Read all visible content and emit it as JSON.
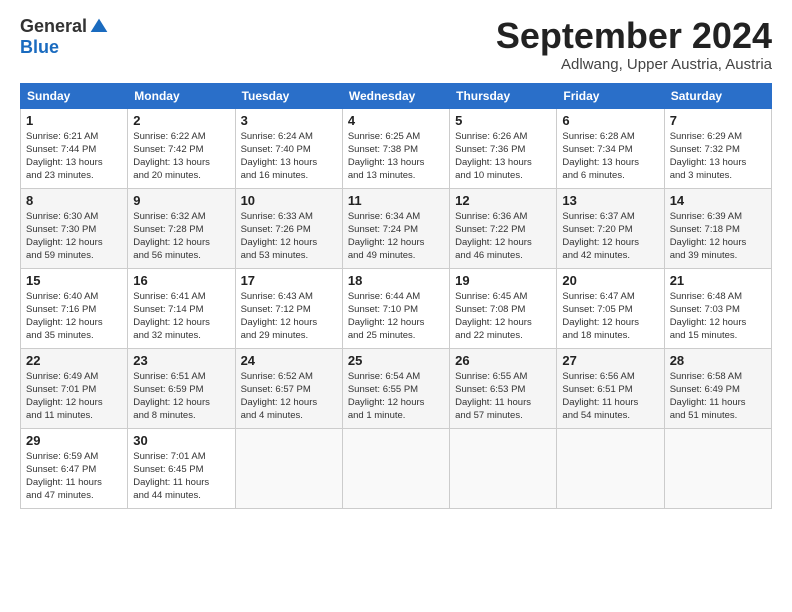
{
  "logo": {
    "general": "General",
    "blue": "Blue"
  },
  "title": "September 2024",
  "subtitle": "Adlwang, Upper Austria, Austria",
  "headers": [
    "Sunday",
    "Monday",
    "Tuesday",
    "Wednesday",
    "Thursday",
    "Friday",
    "Saturday"
  ],
  "weeks": [
    [
      {
        "day": "1",
        "info": "Sunrise: 6:21 AM\nSunset: 7:44 PM\nDaylight: 13 hours\nand 23 minutes."
      },
      {
        "day": "2",
        "info": "Sunrise: 6:22 AM\nSunset: 7:42 PM\nDaylight: 13 hours\nand 20 minutes."
      },
      {
        "day": "3",
        "info": "Sunrise: 6:24 AM\nSunset: 7:40 PM\nDaylight: 13 hours\nand 16 minutes."
      },
      {
        "day": "4",
        "info": "Sunrise: 6:25 AM\nSunset: 7:38 PM\nDaylight: 13 hours\nand 13 minutes."
      },
      {
        "day": "5",
        "info": "Sunrise: 6:26 AM\nSunset: 7:36 PM\nDaylight: 13 hours\nand 10 minutes."
      },
      {
        "day": "6",
        "info": "Sunrise: 6:28 AM\nSunset: 7:34 PM\nDaylight: 13 hours\nand 6 minutes."
      },
      {
        "day": "7",
        "info": "Sunrise: 6:29 AM\nSunset: 7:32 PM\nDaylight: 13 hours\nand 3 minutes."
      }
    ],
    [
      {
        "day": "8",
        "info": "Sunrise: 6:30 AM\nSunset: 7:30 PM\nDaylight: 12 hours\nand 59 minutes."
      },
      {
        "day": "9",
        "info": "Sunrise: 6:32 AM\nSunset: 7:28 PM\nDaylight: 12 hours\nand 56 minutes."
      },
      {
        "day": "10",
        "info": "Sunrise: 6:33 AM\nSunset: 7:26 PM\nDaylight: 12 hours\nand 53 minutes."
      },
      {
        "day": "11",
        "info": "Sunrise: 6:34 AM\nSunset: 7:24 PM\nDaylight: 12 hours\nand 49 minutes."
      },
      {
        "day": "12",
        "info": "Sunrise: 6:36 AM\nSunset: 7:22 PM\nDaylight: 12 hours\nand 46 minutes."
      },
      {
        "day": "13",
        "info": "Sunrise: 6:37 AM\nSunset: 7:20 PM\nDaylight: 12 hours\nand 42 minutes."
      },
      {
        "day": "14",
        "info": "Sunrise: 6:39 AM\nSunset: 7:18 PM\nDaylight: 12 hours\nand 39 minutes."
      }
    ],
    [
      {
        "day": "15",
        "info": "Sunrise: 6:40 AM\nSunset: 7:16 PM\nDaylight: 12 hours\nand 35 minutes."
      },
      {
        "day": "16",
        "info": "Sunrise: 6:41 AM\nSunset: 7:14 PM\nDaylight: 12 hours\nand 32 minutes."
      },
      {
        "day": "17",
        "info": "Sunrise: 6:43 AM\nSunset: 7:12 PM\nDaylight: 12 hours\nand 29 minutes."
      },
      {
        "day": "18",
        "info": "Sunrise: 6:44 AM\nSunset: 7:10 PM\nDaylight: 12 hours\nand 25 minutes."
      },
      {
        "day": "19",
        "info": "Sunrise: 6:45 AM\nSunset: 7:08 PM\nDaylight: 12 hours\nand 22 minutes."
      },
      {
        "day": "20",
        "info": "Sunrise: 6:47 AM\nSunset: 7:05 PM\nDaylight: 12 hours\nand 18 minutes."
      },
      {
        "day": "21",
        "info": "Sunrise: 6:48 AM\nSunset: 7:03 PM\nDaylight: 12 hours\nand 15 minutes."
      }
    ],
    [
      {
        "day": "22",
        "info": "Sunrise: 6:49 AM\nSunset: 7:01 PM\nDaylight: 12 hours\nand 11 minutes."
      },
      {
        "day": "23",
        "info": "Sunrise: 6:51 AM\nSunset: 6:59 PM\nDaylight: 12 hours\nand 8 minutes."
      },
      {
        "day": "24",
        "info": "Sunrise: 6:52 AM\nSunset: 6:57 PM\nDaylight: 12 hours\nand 4 minutes."
      },
      {
        "day": "25",
        "info": "Sunrise: 6:54 AM\nSunset: 6:55 PM\nDaylight: 12 hours\nand 1 minute."
      },
      {
        "day": "26",
        "info": "Sunrise: 6:55 AM\nSunset: 6:53 PM\nDaylight: 11 hours\nand 57 minutes."
      },
      {
        "day": "27",
        "info": "Sunrise: 6:56 AM\nSunset: 6:51 PM\nDaylight: 11 hours\nand 54 minutes."
      },
      {
        "day": "28",
        "info": "Sunrise: 6:58 AM\nSunset: 6:49 PM\nDaylight: 11 hours\nand 51 minutes."
      }
    ],
    [
      {
        "day": "29",
        "info": "Sunrise: 6:59 AM\nSunset: 6:47 PM\nDaylight: 11 hours\nand 47 minutes."
      },
      {
        "day": "30",
        "info": "Sunrise: 7:01 AM\nSunset: 6:45 PM\nDaylight: 11 hours\nand 44 minutes."
      },
      {
        "day": "",
        "info": ""
      },
      {
        "day": "",
        "info": ""
      },
      {
        "day": "",
        "info": ""
      },
      {
        "day": "",
        "info": ""
      },
      {
        "day": "",
        "info": ""
      }
    ]
  ]
}
